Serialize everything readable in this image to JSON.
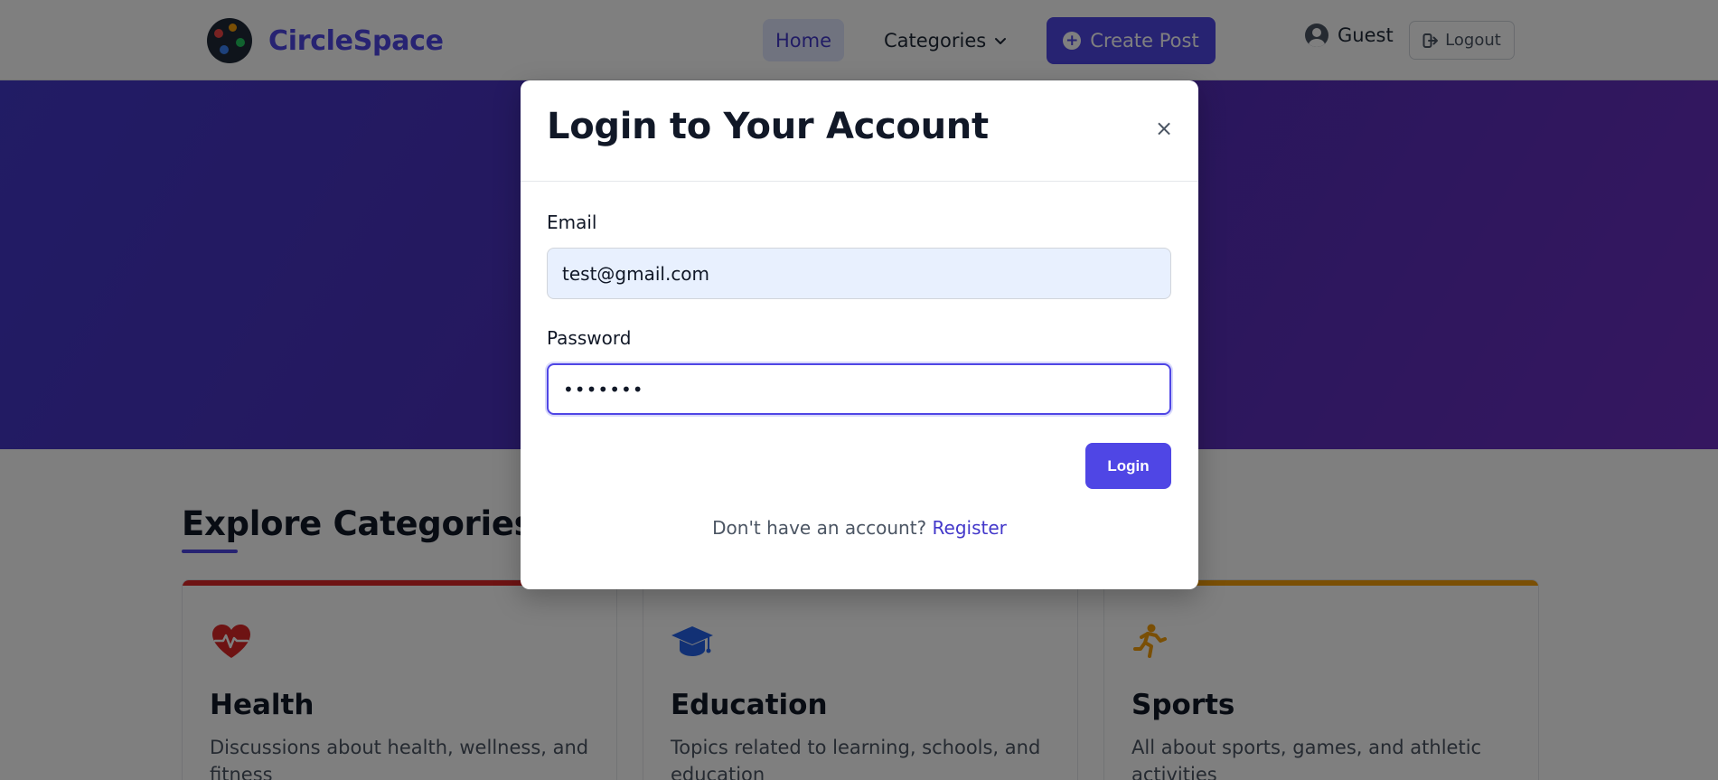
{
  "navbar": {
    "brand_name": "CircleSpace",
    "home_label": "Home",
    "categories_label": "Categories",
    "create_post_label": "Create Post",
    "user_name": "Guest",
    "logout_label": "Logout"
  },
  "categories_section": {
    "title": "Explore Categories",
    "cards": [
      {
        "title": "Health",
        "description": "Discussions about health, wellness, and fitness",
        "accent": "#dc2626",
        "icon": "heart-pulse-icon"
      },
      {
        "title": "Education",
        "description": "Topics related to learning, schools, and education",
        "accent": "#3b82f6",
        "icon": "graduation-cap-icon"
      },
      {
        "title": "Sports",
        "description": "All about sports, games, and athletic activities",
        "accent": "#f59e0b",
        "icon": "running-icon"
      }
    ]
  },
  "modal": {
    "title": "Login to Your Account",
    "close_label": "×",
    "email_label": "Email",
    "email_value": "test@gmail.com",
    "password_label": "Password",
    "password_value": "•••••••",
    "login_label": "Login",
    "register_prompt": "Don't have an account?",
    "register_link": "Register"
  },
  "colors": {
    "primary": "#4f46e5",
    "hero_start": "#4338ca",
    "hero_end": "#6b2fc0"
  }
}
